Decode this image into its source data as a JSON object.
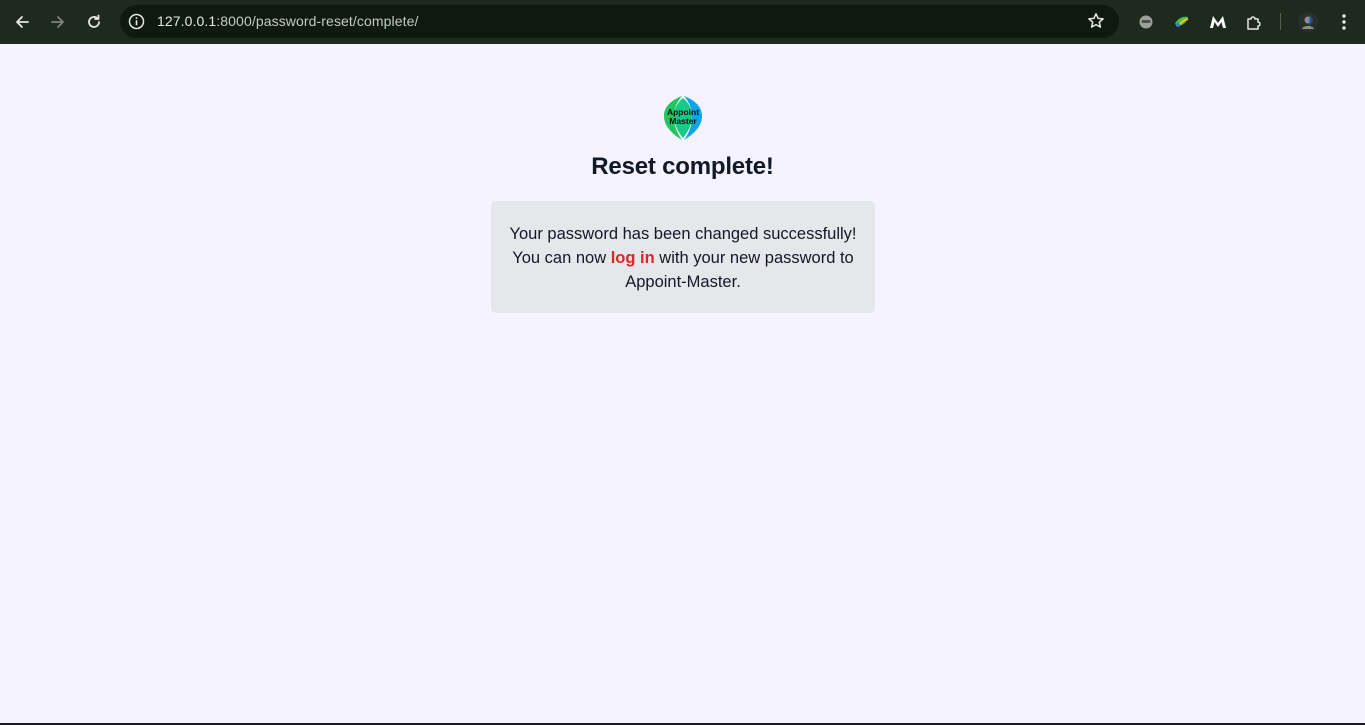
{
  "browser": {
    "url_host": "127.0.0.1",
    "url_rest": ":8000/password-reset/complete/",
    "icons": {
      "back": "back-arrow-icon",
      "forward": "forward-arrow-icon",
      "reload": "reload-icon",
      "info": "site-info-icon",
      "star": "bookmark-star-icon",
      "menu": "kebab-menu-icon"
    }
  },
  "page": {
    "logo_text_line1": "Appoint",
    "logo_text_line2": "Master",
    "title": "Reset complete!",
    "message": {
      "line1": "Your password has been changed successfully!",
      "prefix": "You can now ",
      "link": "log in",
      "suffix": " with your new password to",
      "line3": "Appoint-Master."
    }
  },
  "colors": {
    "background": "#f5f3ff",
    "card": "#e6e7ea",
    "link": "#dc2626",
    "title": "#111827",
    "logo_green": "#22c55e",
    "logo_blue": "#0ea5e9"
  }
}
